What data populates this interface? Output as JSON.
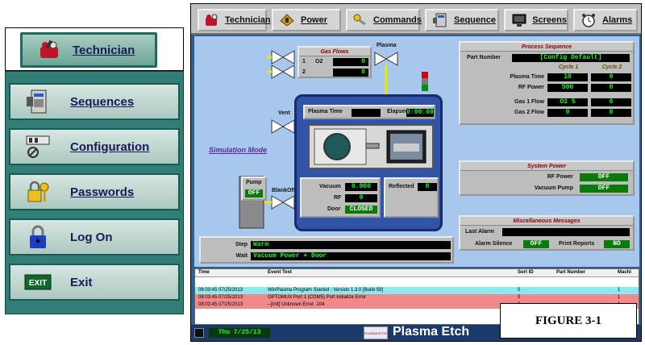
{
  "left_menu": {
    "tab_label": "Technician",
    "items": [
      {
        "label": "Sequences",
        "icon": "sequences-icon"
      },
      {
        "label": "Configuration",
        "icon": "configuration-icon"
      },
      {
        "label": "Passwords",
        "icon": "passwords-icon"
      },
      {
        "label": "Log On",
        "icon": "lock-icon"
      },
      {
        "label": "Exit",
        "icon": "exit-icon"
      }
    ]
  },
  "toolbar": {
    "buttons": [
      {
        "label": "Technician"
      },
      {
        "label": "Power"
      },
      {
        "label": "Commands"
      },
      {
        "label": "Sequence"
      },
      {
        "label": "Screens"
      },
      {
        "label": "Alarms"
      }
    ]
  },
  "gas_flows": {
    "title": "Gas Flows",
    "rows": [
      {
        "index": "1",
        "name": "O2",
        "value": "0"
      },
      {
        "index": "2",
        "name": "",
        "value": "0"
      }
    ]
  },
  "plasma_label": "Plasma",
  "vent_label": "Vent",
  "blankoff_label": "BlankOff",
  "simulation_mode": "Simulation Mode",
  "pump": {
    "label": "Pump",
    "value": "OFF"
  },
  "chamber": {
    "plasma_time_label": "Plasma Time",
    "plasma_time_value": "",
    "elapsed_label": "Elapsed",
    "elapsed_value": "0:00:00",
    "vacuum_label": "Vacuum",
    "vacuum_value": "0.000",
    "rf_label": "RF",
    "rf_value": "0",
    "door_label": "Door",
    "door_value": "CLOSED",
    "reflected_label": "Reflected",
    "reflected_value": "0"
  },
  "process_sequence": {
    "title": "Process Sequence",
    "part_number_label": "Part Number",
    "part_number_value": "[Config Default]",
    "cycle1_label": "Cycle 1",
    "cycle2_label": "Cycle 2",
    "rows": [
      {
        "label": "Plasma Time",
        "c1": "10",
        "c2": "0"
      },
      {
        "label": "RF Power",
        "c1": "500",
        "c2": "0"
      },
      {
        "label": "Gas 1 Flow",
        "c1": "O2 5",
        "c2": "0"
      },
      {
        "label": "Gas 2 Flow",
        "c1": "0",
        "c2": "0"
      }
    ]
  },
  "system_power": {
    "title": "System Power",
    "rf_power_label": "RF Power",
    "rf_power_value": "OFF",
    "vacuum_pump_label": "Vacuum Pump",
    "vacuum_pump_value": "OFF"
  },
  "misc_messages": {
    "title": "Miscellaneous Messages",
    "last_alarm_label": "Last Alarm",
    "last_alarm_value": "",
    "alarm_silence_label": "Alarm Silence",
    "alarm_silence_value": "OFF",
    "print_reports_label": "Print Reports",
    "print_reports_value": "NO"
  },
  "step": {
    "label": "Step",
    "value": "Warm"
  },
  "wait": {
    "label": "Wait",
    "value": "Vacuum Power + Door"
  },
  "log": {
    "headers": [
      "Time",
      "Event Text",
      "Sort ID",
      "Part Number",
      "Machi"
    ],
    "rows": [
      {
        "time": "08:03:45 07/25/2013",
        "text": "WinPlasma Program Started - Version 1.3.0  [Build 59]",
        "sort": "0",
        "part": "",
        "mach": "1",
        "color": "#8fe8f0"
      },
      {
        "time": "08:03:45 07/25/2013",
        "text": "OPTOMUX Port 1 (COM5) Port Initialize Error",
        "sort": "0",
        "part": "",
        "mach": "1",
        "color": "#f08a8a"
      },
      {
        "time": "08:03:45 07/25/2013",
        "text": "--[Init]  Unknown Error  -104",
        "sort": "0",
        "part": "",
        "mach": "1",
        "color": "#f08a8a"
      }
    ]
  },
  "status": {
    "date": "Thu 7/25/13",
    "brand_small": "PLASMA ETCH",
    "brand": "Plasma Etch"
  },
  "figure_label": "FIGURE 3-1"
}
